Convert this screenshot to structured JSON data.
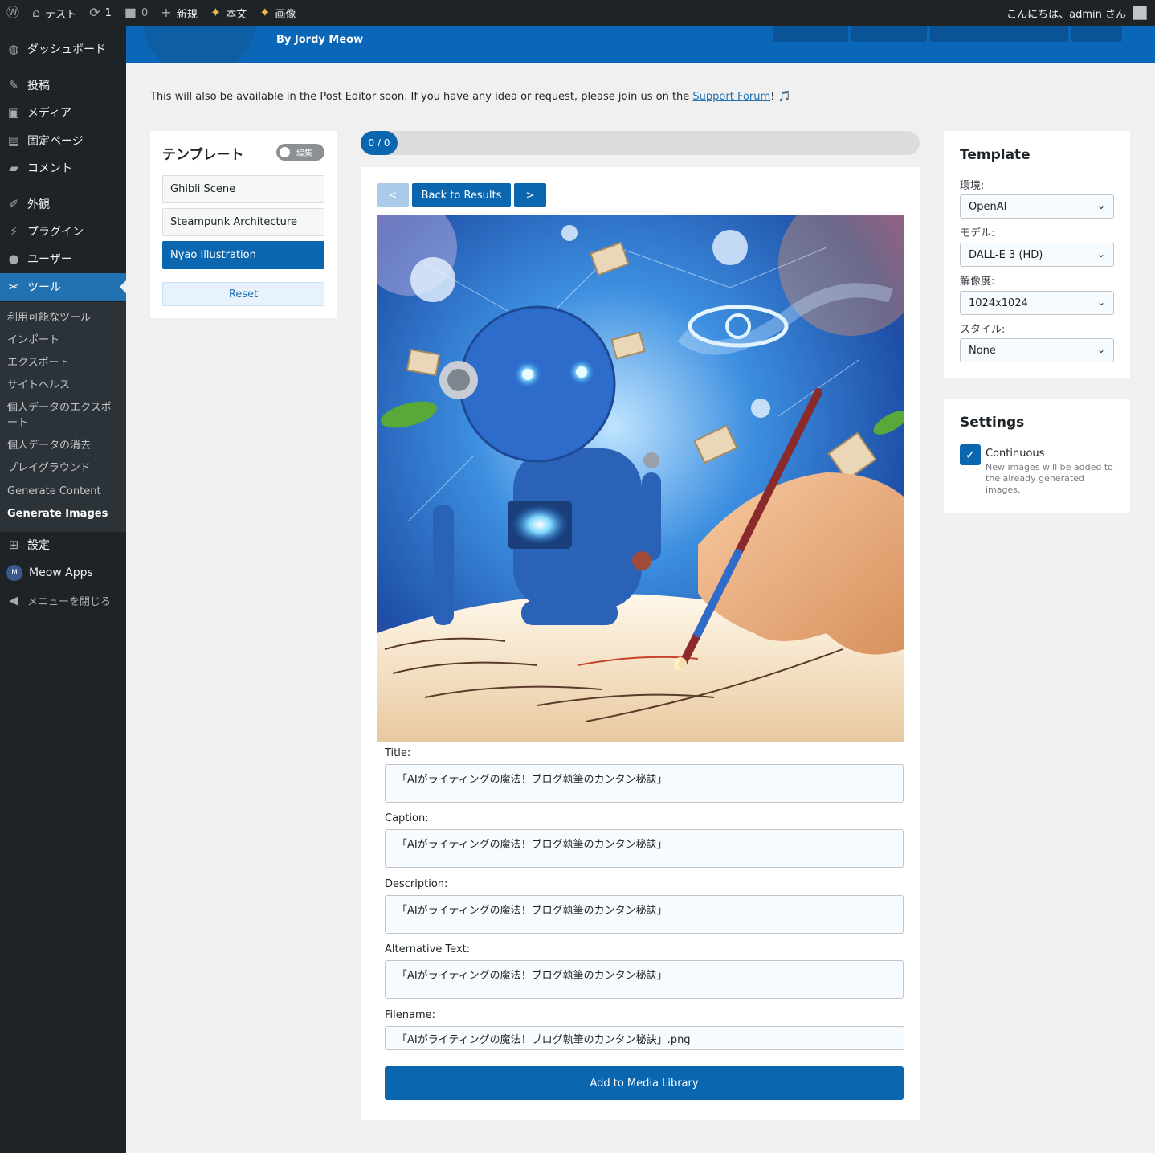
{
  "adminbar": {
    "site_name": "テスト",
    "updates_count": "1",
    "comments_count": "0",
    "new_label": "新規",
    "content_label": "本文",
    "images_label": "画像",
    "greeting": "こんにちは、admin さん"
  },
  "sidebar": {
    "items": [
      {
        "label": "ダッシュボード",
        "icon": "dashboard-icon"
      },
      {
        "label": "投稿",
        "icon": "pin-icon"
      },
      {
        "label": "メディア",
        "icon": "media-icon"
      },
      {
        "label": "固定ページ",
        "icon": "page-icon"
      },
      {
        "label": "コメント",
        "icon": "comment-icon"
      },
      {
        "label": "外観",
        "icon": "brush-icon"
      },
      {
        "label": "プラグイン",
        "icon": "plugin-icon"
      },
      {
        "label": "ユーザー",
        "icon": "user-icon"
      },
      {
        "label": "ツール",
        "icon": "wrench-icon"
      },
      {
        "label": "設定",
        "icon": "settings-icon"
      },
      {
        "label": "Meow Apps",
        "icon": "meow-apps-icon"
      },
      {
        "label": "メニューを閉じる",
        "icon": "collapse-icon"
      }
    ],
    "submenu": [
      "利用可能なツール",
      "インポート",
      "エクスポート",
      "サイトヘルス",
      "個人データのエクスポート",
      "個人データの消去",
      "プレイグラウンド",
      "Generate Content",
      "Generate Images"
    ]
  },
  "header": {
    "byline": "By Jordy Meow"
  },
  "notice": {
    "text": "This will also be available in the Post Editor soon. If you have any idea or request, please join us on the ",
    "link": "Support Forum",
    "suffix": "! 🎵"
  },
  "templates": {
    "title": "テンプレート",
    "toggle_label": "編集",
    "items": [
      "Ghibli Scene",
      "Steampunk Architecture",
      "Nyao Illustration"
    ],
    "selected": "Nyao Illustration",
    "reset_label": "Reset"
  },
  "progress": {
    "label": "0 / 0",
    "fraction": 0.066
  },
  "navigation": {
    "prev_label": "<",
    "back_label": "Back to Results",
    "next_label": ">"
  },
  "fields": {
    "title_label": "Title:",
    "title_value": "「AIがライティングの魔法！ブログ執筆のカンタン秘訣」",
    "caption_label": "Caption:",
    "caption_value": "「AIがライティングの魔法！ブログ執筆のカンタン秘訣」",
    "description_label": "Description:",
    "description_value": "「AIがライティングの魔法！ブログ執筆のカンタン秘訣」",
    "alt_label": "Alternative Text:",
    "alt_value": "「AIがライティングの魔法！ブログ執筆のカンタン秘訣」",
    "filename_label": "Filename:",
    "filename_value": "「AIがライティングの魔法！ブログ執筆のカンタン秘訣」.png"
  },
  "add_button_label": "Add to Media Library",
  "template_panel": {
    "title": "Template",
    "env_label": "環境:",
    "env_value": "OpenAI",
    "model_label": "モデル:",
    "model_value": "DALL-E 3 (HD)",
    "resolution_label": "解像度:",
    "resolution_value": "1024x1024",
    "style_label": "スタイル:",
    "style_value": "None"
  },
  "settings_panel": {
    "title": "Settings",
    "continuous_label": "Continuous",
    "continuous_checked": true,
    "continuous_desc": "New images will be added to the already generated images."
  },
  "colors": {
    "accent": "#0b66b0",
    "admin_bg": "#1d2327",
    "header_blue": "#0a66b7"
  }
}
